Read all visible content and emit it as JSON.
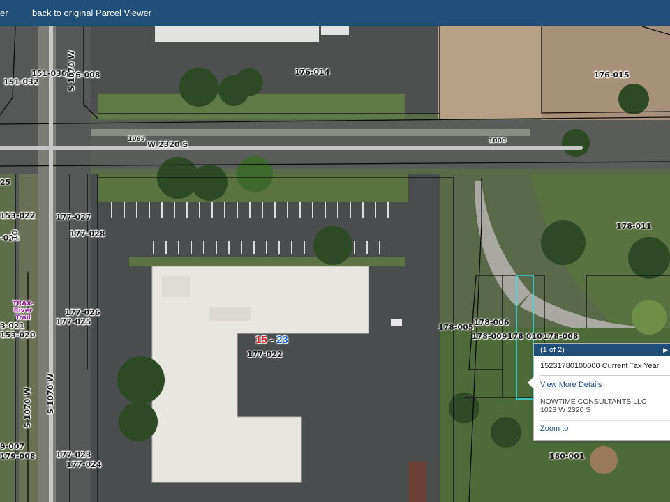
{
  "topbar": {
    "partial_link": "er",
    "back_link": "back to original Parcel Viewer"
  },
  "map": {
    "street_label": "W 2320 S",
    "address_1069": "1069",
    "address_1000": "1000",
    "street_1070w_a": "S 1070 W",
    "street_1070w_b": "S 1070 W",
    "street_1070w_c": "S 1070 W",
    "street_10": "10",
    "trax": "TRAX-\nRiver\nTrail",
    "block": {
      "left": "15",
      "sep": "-",
      "right": "23"
    },
    "parcels": {
      "p151_030": "151-030",
      "p151_032": "151-032",
      "p176_008": "176-008",
      "p176_014": "176-014",
      "p176_015": "176-015",
      "p25": "25",
      "p153_022": "153-022",
      "p023": "-023",
      "p177_027": "177-027",
      "p177_028": "177-028",
      "p178_011": "178-011",
      "p177_026": "177-026",
      "p177_025": "177-025",
      "p3_021": "3-021",
      "p153_020": "153-020",
      "p178_005": "178-005",
      "p178_006": "178-006",
      "p178_009": "178-009",
      "p178_010": "178 010",
      "p178_008": "178-008",
      "p177_022": "177-022",
      "p9_007": "9-007",
      "p179_008": "179-008",
      "p177_023": "177-023",
      "p177_024": "177-024",
      "p180_001": "180-001"
    }
  },
  "popup": {
    "header": "(1 of 2)",
    "next_icon": "▶",
    "title": "15231780100000 Current Tax Year",
    "more_details": "View More Details",
    "owner": "NOWTIME CONSULTANTS LLC",
    "address": "1023 W 2320 S",
    "zoom": "Zoom to"
  }
}
